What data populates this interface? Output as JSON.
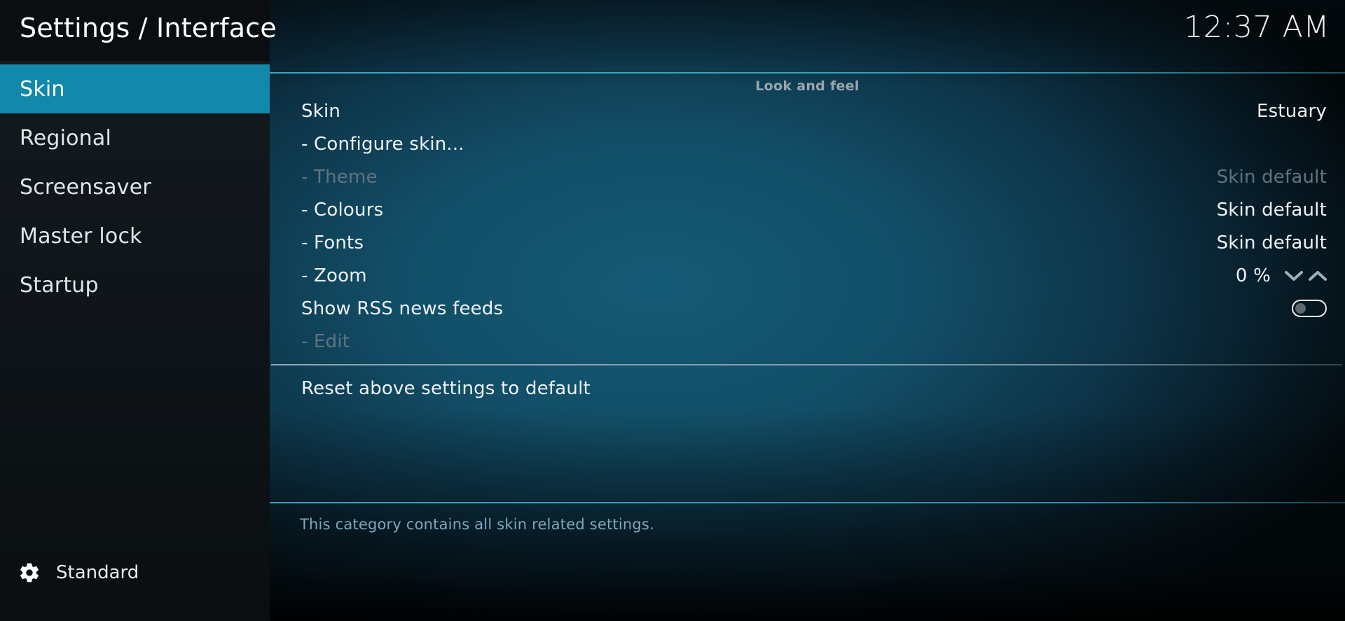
{
  "header": {
    "title": "Settings / Interface",
    "clock": "12:37 AM"
  },
  "sidebar": {
    "items": [
      {
        "label": "Skin",
        "selected": true
      },
      {
        "label": "Regional",
        "selected": false
      },
      {
        "label": "Screensaver",
        "selected": false
      },
      {
        "label": "Master lock",
        "selected": false
      },
      {
        "label": "Startup",
        "selected": false
      }
    ],
    "profile": {
      "icon": "gear-icon",
      "label": "Standard"
    }
  },
  "content": {
    "group_title": "Look and feel",
    "rows": [
      {
        "label": "Skin",
        "value": "Estuary",
        "control": "value",
        "disabled": false
      },
      {
        "label": "- Configure skin...",
        "value": "",
        "control": "none",
        "disabled": false
      },
      {
        "label": "- Theme",
        "value": "Skin default",
        "control": "value",
        "disabled": true
      },
      {
        "label": "- Colours",
        "value": "Skin default",
        "control": "value",
        "disabled": false
      },
      {
        "label": "- Fonts",
        "value": "Skin default",
        "control": "value",
        "disabled": false
      },
      {
        "label": "- Zoom",
        "value": "0 %",
        "control": "spinner",
        "disabled": false
      },
      {
        "label": "Show RSS news feeds",
        "value": "",
        "control": "toggle",
        "toggle_on": false,
        "disabled": false
      },
      {
        "label": "- Edit",
        "value": "",
        "control": "none",
        "disabled": true
      }
    ],
    "reset_row": {
      "label": "Reset above settings to default"
    }
  },
  "footer": {
    "description": "This category contains all skin related settings."
  },
  "colors": {
    "accent": "#1288ab",
    "rule": "#3dadc9",
    "text": "#eef3f6",
    "text_disabled": "#5f7480",
    "footer_text": "#7fa8bd",
    "sidebar_bg": "#10151a",
    "header_bg": "#0b0e11"
  }
}
